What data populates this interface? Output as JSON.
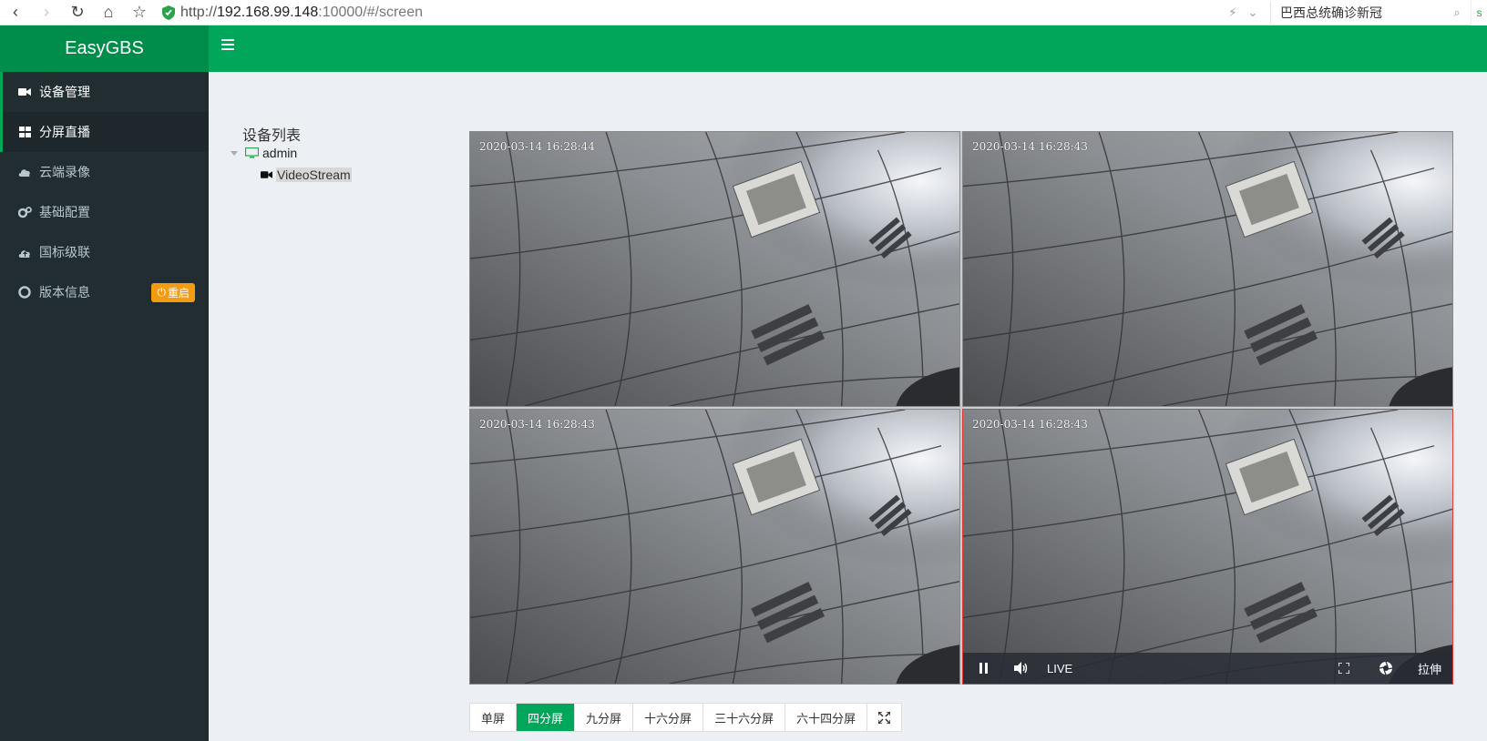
{
  "browser": {
    "url_scheme": "http://",
    "url_host": "192.168.99.148",
    "url_rest": ":10000/#/screen",
    "search_text": "巴西总统确诊新冠"
  },
  "header": {
    "app_title": "EasyGBS"
  },
  "sidebar": {
    "items": [
      {
        "label": "设备管理",
        "icon": "video-camera-icon"
      },
      {
        "label": "分屏直播",
        "icon": "grid-icon"
      },
      {
        "label": "云端录像",
        "icon": "cloud-icon"
      },
      {
        "label": "基础配置",
        "icon": "gears-icon"
      },
      {
        "label": "国标级联",
        "icon": "cloud-upload-icon"
      },
      {
        "label": "版本信息",
        "icon": "lifebuoy-icon"
      }
    ],
    "restart_badge": "重启"
  },
  "tree": {
    "title": "设备列表",
    "root": "admin",
    "leaf": "VideoStream"
  },
  "videos": {
    "timestamps": [
      "2020-03-14 16:28:44",
      "2020-03-14 16:28:43",
      "2020-03-14 16:28:43",
      "2020-03-14 16:28:43"
    ],
    "live_label": "LIVE",
    "stretch_label": "拉伸"
  },
  "split": {
    "buttons": [
      "单屏",
      "四分屏",
      "九分屏",
      "十六分屏",
      "三十六分屏",
      "六十四分屏"
    ],
    "active_index": 1
  },
  "colors": {
    "brand_green": "#00a65a",
    "sidebar_bg": "#222d32",
    "badge_orange": "#f39c12",
    "selected_border": "#e53935"
  }
}
